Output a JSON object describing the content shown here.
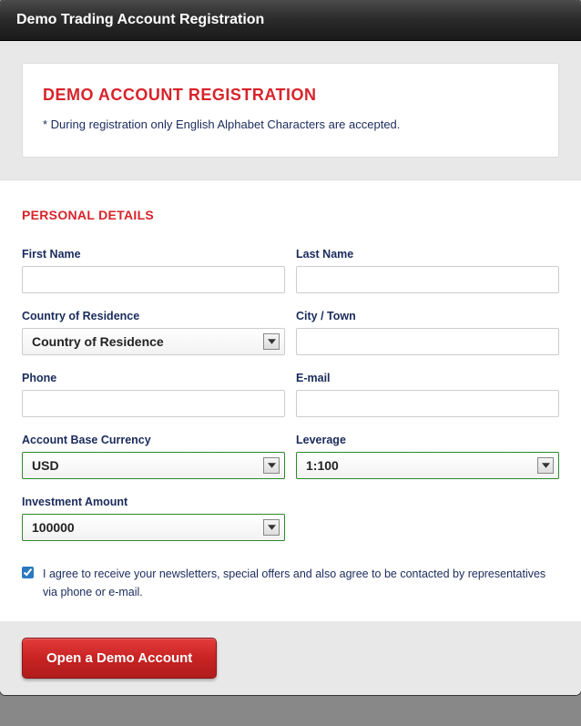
{
  "window": {
    "title": "Demo Trading Account Registration"
  },
  "infobox": {
    "heading": "DEMO ACCOUNT REGISTRATION",
    "note": "* During registration only English Alphabet Characters are accepted."
  },
  "section": {
    "title": "PERSONAL DETAILS"
  },
  "fields": {
    "first_name": {
      "label": "First Name",
      "value": ""
    },
    "last_name": {
      "label": "Last Name",
      "value": ""
    },
    "country": {
      "label": "Country of Residence",
      "selected": "Country of Residence"
    },
    "city": {
      "label": "City / Town",
      "value": ""
    },
    "phone": {
      "label": "Phone",
      "value": ""
    },
    "email": {
      "label": "E-mail",
      "value": ""
    },
    "currency": {
      "label": "Account Base Currency",
      "selected": "USD"
    },
    "leverage": {
      "label": "Leverage",
      "selected": "1:100"
    },
    "investment": {
      "label": "Investment Amount",
      "selected": "100000"
    }
  },
  "consent": {
    "checked": true,
    "text": "I agree to receive your newsletters, special offers and also agree to be contacted by representatives via phone or e-mail."
  },
  "submit": {
    "label": "Open a Demo Account"
  }
}
